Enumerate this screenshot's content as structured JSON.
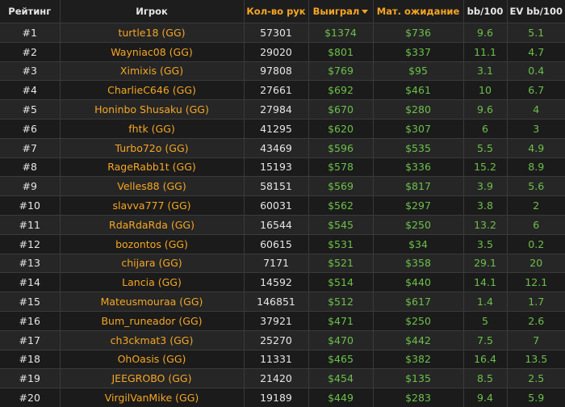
{
  "header": {
    "rank": "Рейтинг",
    "player": "Игрок",
    "hands": "Кол-во рук",
    "won": "Выиграл",
    "ev": "Мат. ожидание",
    "bb100": "bb/100",
    "evbb100": "EV bb/100"
  },
  "colors": {
    "accent": "#f5a623",
    "positive": "#6cc04a",
    "text": "#e6e6e6",
    "background": "#1b1b1b"
  },
  "sort_icon": "caret-down-icon",
  "rows": [
    {
      "rank": "#1",
      "player": "turtle18 (GG)",
      "hands": "57301",
      "won": "$1374",
      "ev": "$736",
      "bb100": "9.6",
      "evbb100": "5.1"
    },
    {
      "rank": "#2",
      "player": "Wayniac08 (GG)",
      "hands": "29020",
      "won": "$801",
      "ev": "$337",
      "bb100": "11.1",
      "evbb100": "4.7"
    },
    {
      "rank": "#3",
      "player": "Ximixis (GG)",
      "hands": "97808",
      "won": "$769",
      "ev": "$95",
      "bb100": "3.1",
      "evbb100": "0.4"
    },
    {
      "rank": "#4",
      "player": "CharlieC646 (GG)",
      "hands": "27661",
      "won": "$692",
      "ev": "$461",
      "bb100": "10",
      "evbb100": "6.7"
    },
    {
      "rank": "#5",
      "player": "Honinbo Shusaku (GG)",
      "hands": "27984",
      "won": "$670",
      "ev": "$280",
      "bb100": "9.6",
      "evbb100": "4"
    },
    {
      "rank": "#6",
      "player": "fhtk (GG)",
      "hands": "41295",
      "won": "$620",
      "ev": "$307",
      "bb100": "6",
      "evbb100": "3"
    },
    {
      "rank": "#7",
      "player": "Turbo72o (GG)",
      "hands": "43469",
      "won": "$596",
      "ev": "$535",
      "bb100": "5.5",
      "evbb100": "4.9"
    },
    {
      "rank": "#8",
      "player": "RageRabb1t (GG)",
      "hands": "15193",
      "won": "$578",
      "ev": "$336",
      "bb100": "15.2",
      "evbb100": "8.9"
    },
    {
      "rank": "#9",
      "player": "Velles88 (GG)",
      "hands": "58151",
      "won": "$569",
      "ev": "$817",
      "bb100": "3.9",
      "evbb100": "5.6"
    },
    {
      "rank": "#10",
      "player": "slavva777 (GG)",
      "hands": "60031",
      "won": "$562",
      "ev": "$297",
      "bb100": "3.8",
      "evbb100": "2"
    },
    {
      "rank": "#11",
      "player": "RdaRdaRda (GG)",
      "hands": "16544",
      "won": "$545",
      "ev": "$250",
      "bb100": "13.2",
      "evbb100": "6"
    },
    {
      "rank": "#12",
      "player": "bozontos (GG)",
      "hands": "60615",
      "won": "$531",
      "ev": "$34",
      "bb100": "3.5",
      "evbb100": "0.2"
    },
    {
      "rank": "#13",
      "player": "chijara (GG)",
      "hands": "7171",
      "won": "$521",
      "ev": "$358",
      "bb100": "29.1",
      "evbb100": "20"
    },
    {
      "rank": "#14",
      "player": "Lancia (GG)",
      "hands": "14592",
      "won": "$514",
      "ev": "$440",
      "bb100": "14.1",
      "evbb100": "12.1"
    },
    {
      "rank": "#15",
      "player": "Mateusmouraa (GG)",
      "hands": "146851",
      "won": "$512",
      "ev": "$617",
      "bb100": "1.4",
      "evbb100": "1.7"
    },
    {
      "rank": "#16",
      "player": "Bum_runeador (GG)",
      "hands": "37921",
      "won": "$471",
      "ev": "$250",
      "bb100": "5",
      "evbb100": "2.6"
    },
    {
      "rank": "#17",
      "player": "ch3ckmat3 (GG)",
      "hands": "25270",
      "won": "$470",
      "ev": "$442",
      "bb100": "7.5",
      "evbb100": "7"
    },
    {
      "rank": "#18",
      "player": "OhOasis (GG)",
      "hands": "11331",
      "won": "$465",
      "ev": "$382",
      "bb100": "16.4",
      "evbb100": "13.5"
    },
    {
      "rank": "#19",
      "player": "JEEGROBO (GG)",
      "hands": "21420",
      "won": "$454",
      "ev": "$135",
      "bb100": "8.5",
      "evbb100": "2.5"
    },
    {
      "rank": "#20",
      "player": "VirgilVanMike (GG)",
      "hands": "19189",
      "won": "$449",
      "ev": "$283",
      "bb100": "9.4",
      "evbb100": "5.9"
    }
  ]
}
